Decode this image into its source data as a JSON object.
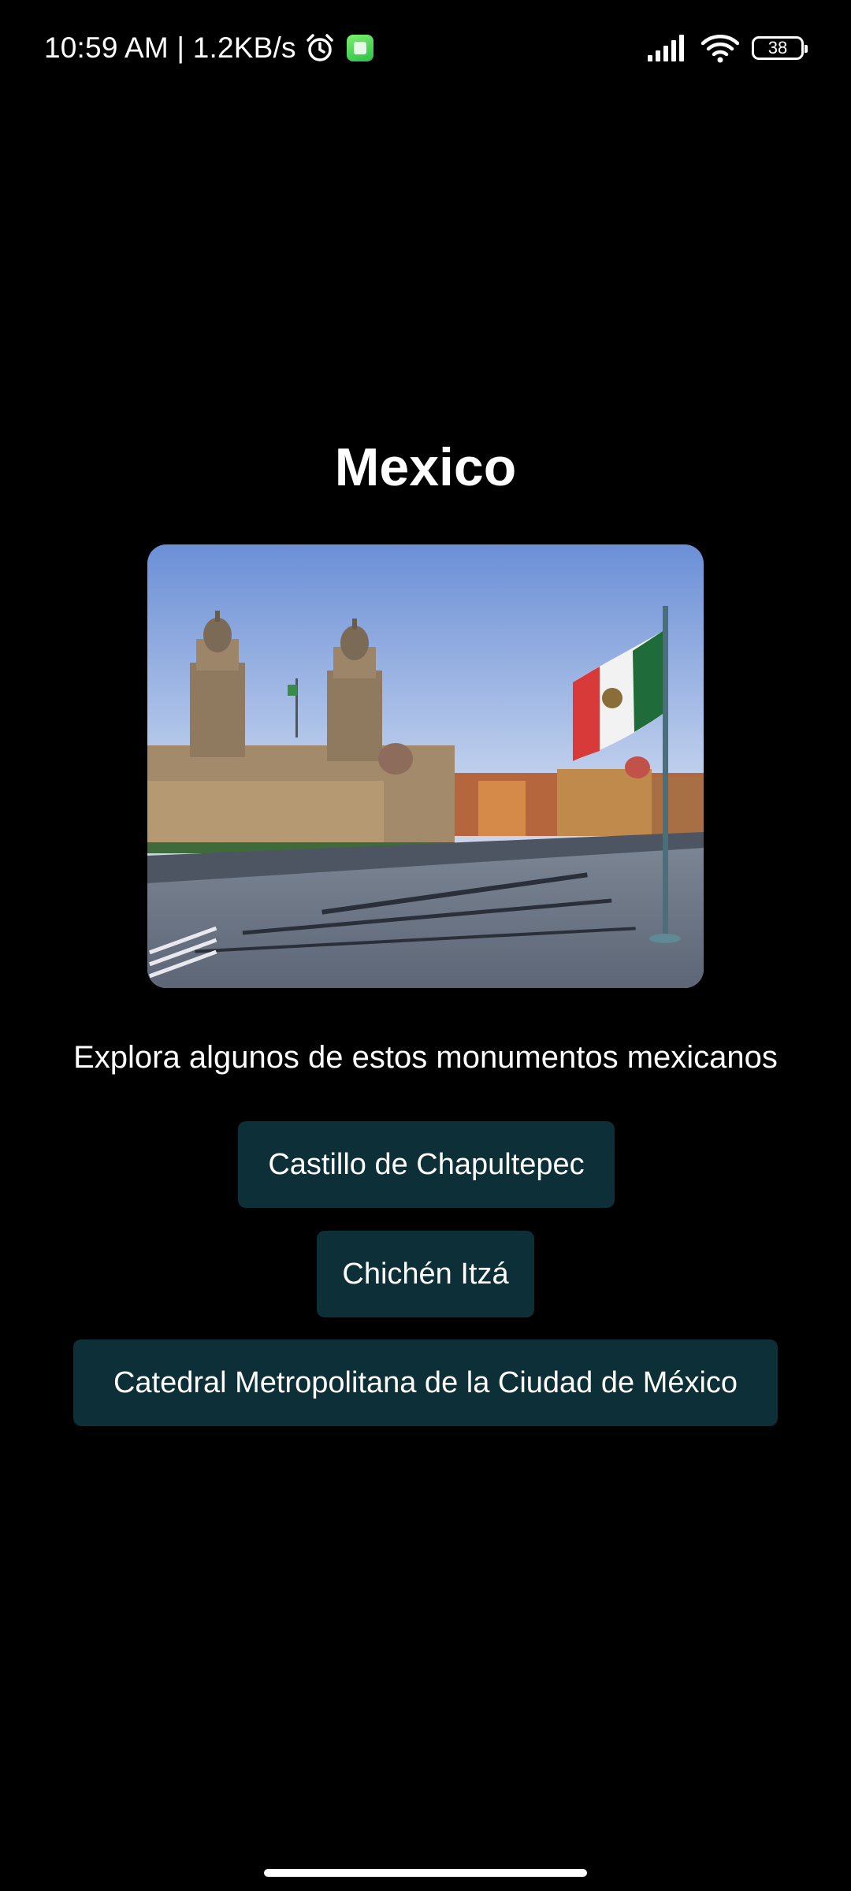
{
  "status_bar": {
    "time_speed": "10:59 AM | 1.2KB/s",
    "battery_level": "38",
    "icons": [
      "alarm-icon",
      "app-notification-icon",
      "signal-icon",
      "wifi-icon",
      "battery-icon"
    ]
  },
  "main": {
    "title": "Mexico",
    "subtitle": "Explora algunos de estos monumentos mexicanos",
    "buttons": [
      {
        "label": "Castillo de Chapultepec"
      },
      {
        "label": "Chichén Itzá"
      },
      {
        "label": "Catedral Metropolitana de la Ciudad de México"
      }
    ]
  },
  "colors": {
    "background": "#000000",
    "button_bg": "#0d2f38",
    "text": "#ffffff"
  }
}
